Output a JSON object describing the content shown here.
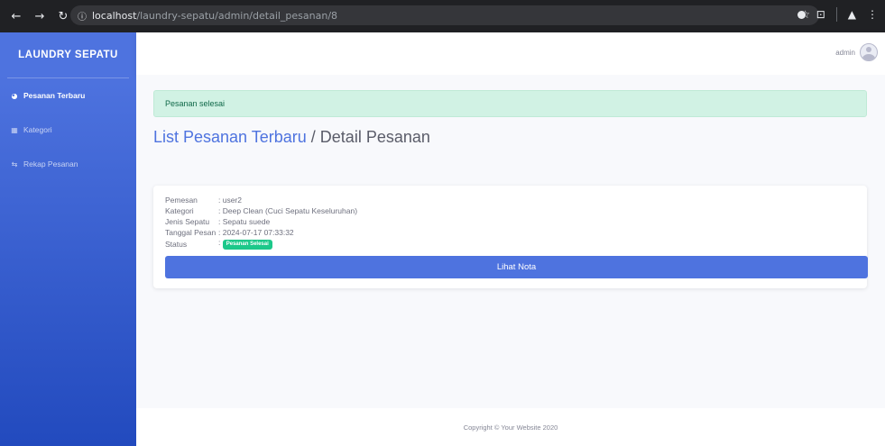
{
  "browser": {
    "url_host": "localhost",
    "url_path": "/laundry-sepatu/admin/detail_pesanan/8",
    "icons": [
      "back-icon",
      "forward-icon",
      "reload-icon",
      "site-info-icon",
      "star-icon",
      "extension-icon",
      "tab-search-icon",
      "profile-icon",
      "menu-icon"
    ]
  },
  "sidebar": {
    "brand": "LAUNDRY SEPATU",
    "items": [
      {
        "label": "Pesanan Terbaru",
        "icon": "dashboard-icon",
        "active": true
      },
      {
        "label": "Kategori",
        "icon": "table-icon",
        "active": false
      },
      {
        "label": "Rekap Pesanan",
        "icon": "sync-icon",
        "active": false
      }
    ]
  },
  "topbar": {
    "username": "admin",
    "avatar_icon": "user-avatar-icon"
  },
  "alert": {
    "message": "Pesanan selesai"
  },
  "heading": {
    "link": "List Pesanan Terbaru",
    "separator": " / ",
    "current": "Detail Pesanan"
  },
  "detail": {
    "rows": [
      {
        "label": "Pemesan",
        "value": ": user2"
      },
      {
        "label": "Kategori",
        "value": ": Deep Clean (Cuci Sepatu Keseluruhan)"
      },
      {
        "label": "Jenis Sepatu",
        "value": ": Sepatu suede"
      },
      {
        "label": "Tanggal Pesan",
        "value": ": 2024-07-17 07:33:32"
      }
    ],
    "status_label": "Status",
    "status_prefix": ": ",
    "status_badge": "Pesanan Selesai"
  },
  "button": {
    "lihat_nota": "Lihat Nota"
  },
  "footer": {
    "copyright": "Copyright © Your Website 2020"
  },
  "colors": {
    "primary": "#4e73df",
    "success": "#1cc88a",
    "alert_bg": "#d1f2e4"
  }
}
